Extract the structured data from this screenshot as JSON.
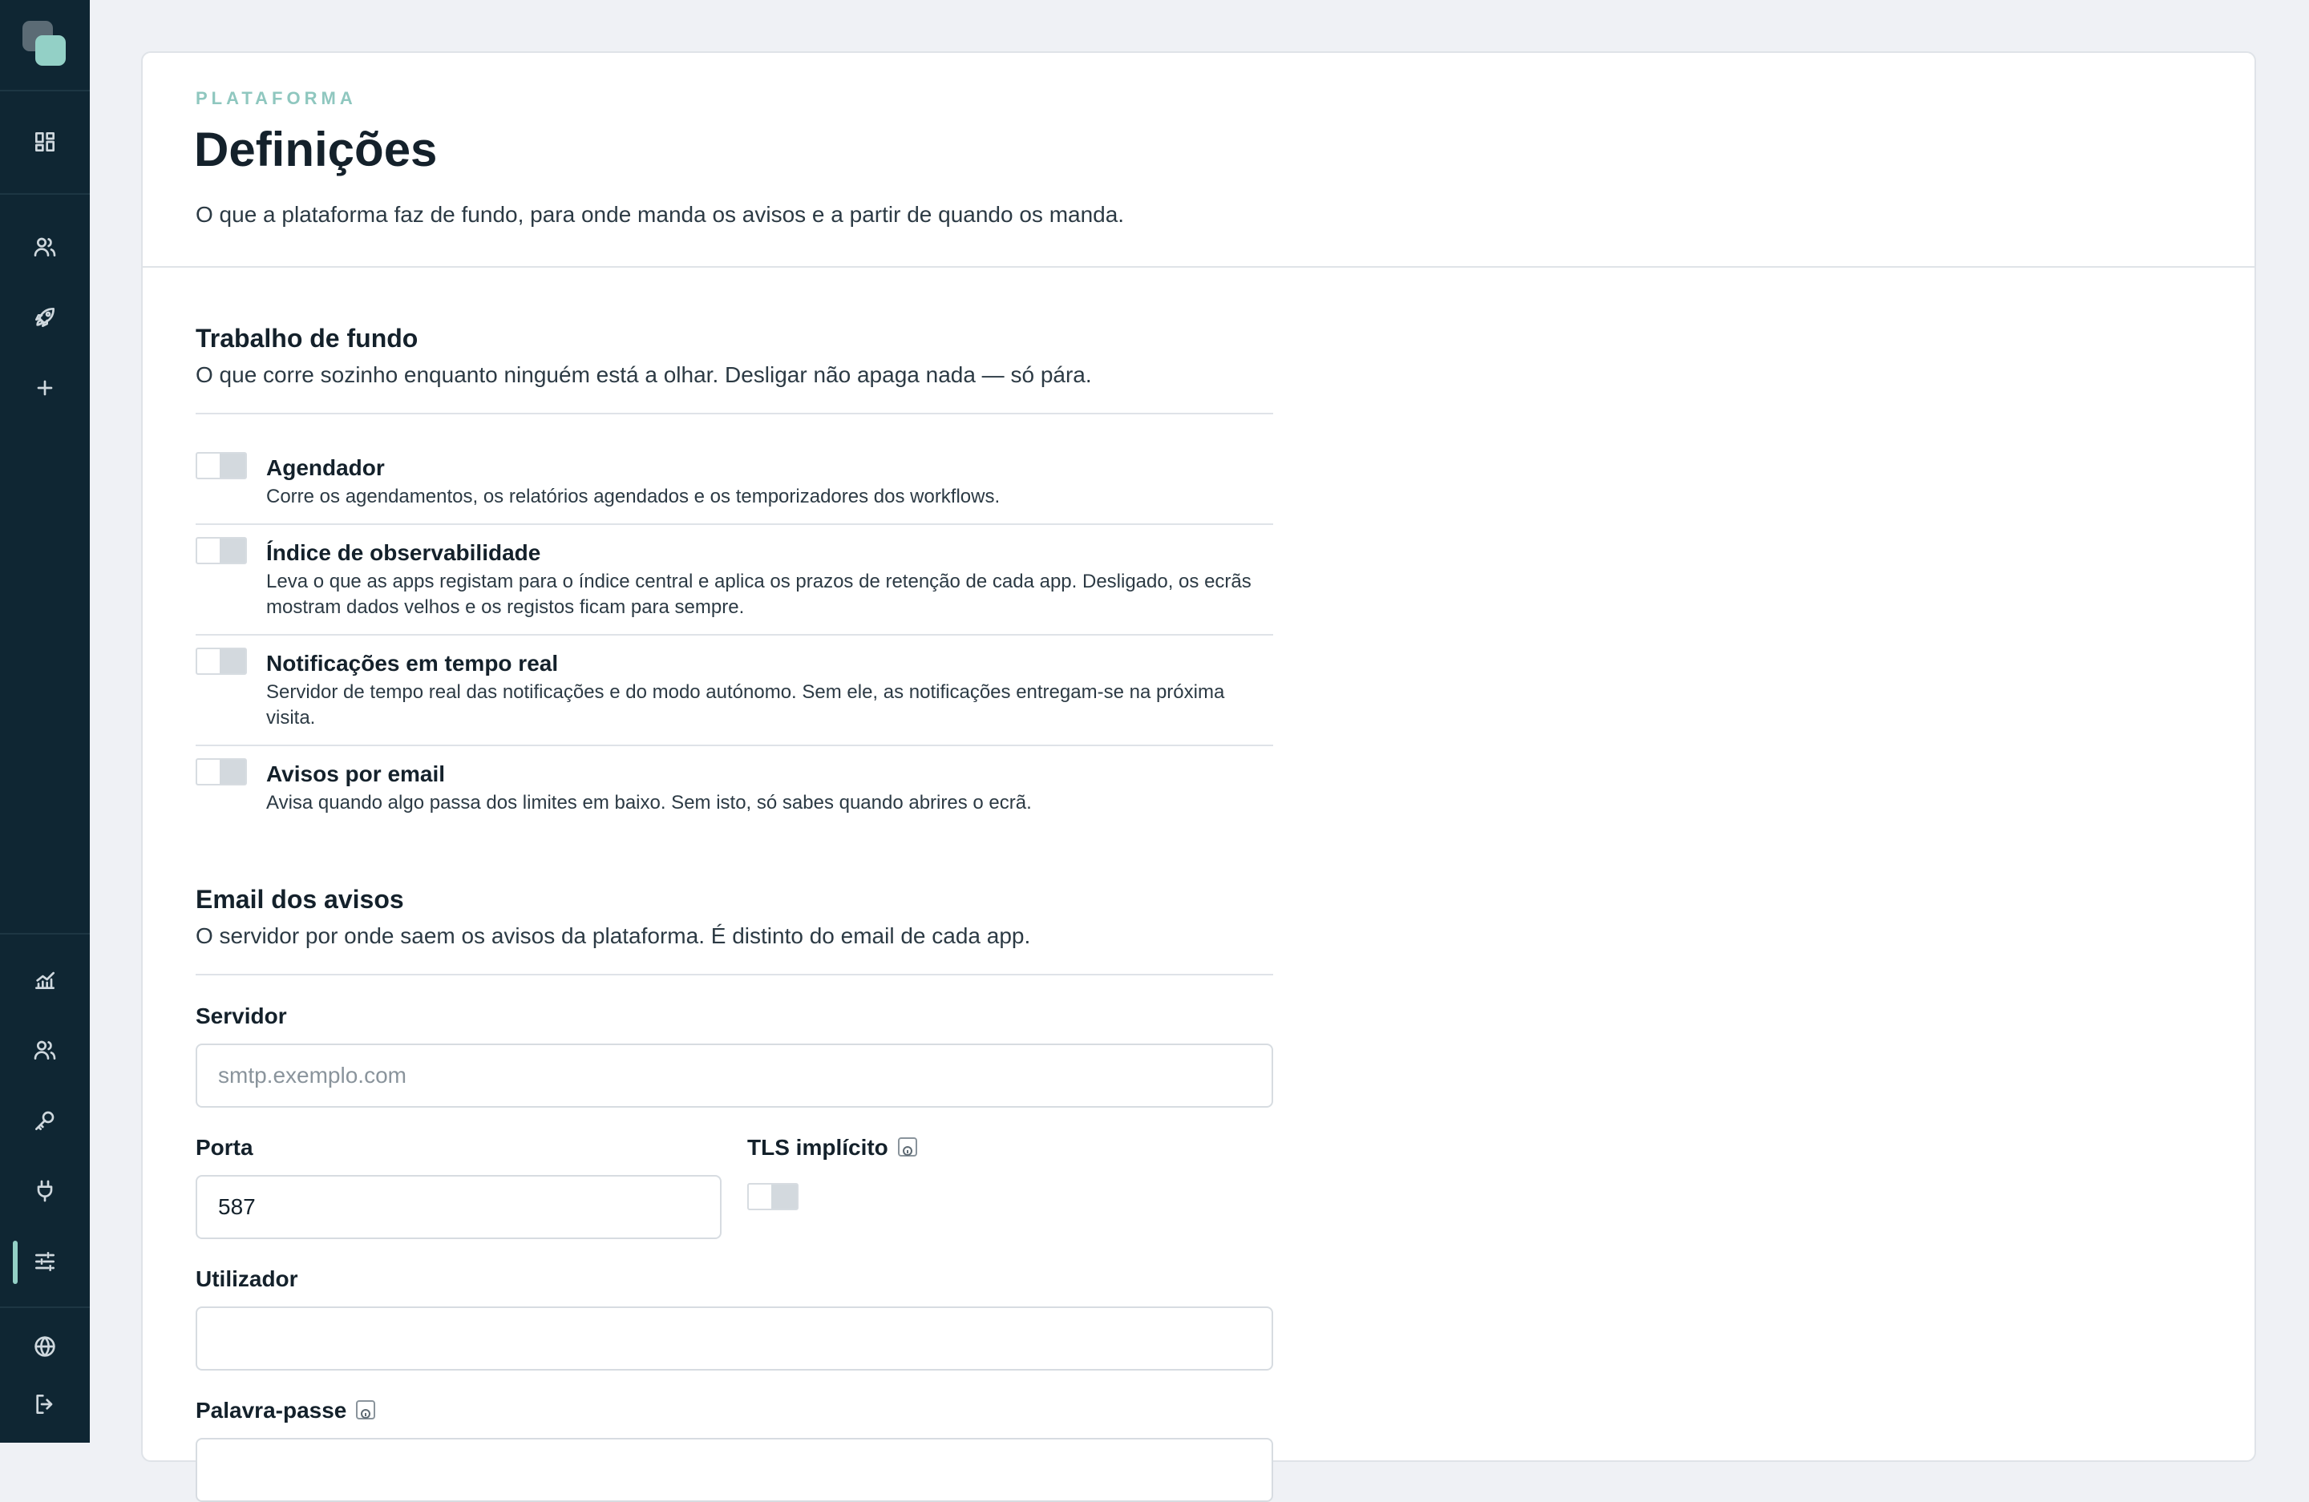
{
  "header": {
    "eyebrow": "PLATAFORMA",
    "title": "Definições",
    "description": "O que a plataforma faz de fundo, para onde manda os avisos e a partir de quando os manda."
  },
  "background_section": {
    "title": "Trabalho de fundo",
    "description": "O que corre sozinho enquanto ninguém está a olhar. Desligar não apaga nada — só pára.",
    "options": [
      {
        "title": "Agendador",
        "description": "Corre os agendamentos, os relatórios agendados e os temporizadores dos workflows.",
        "enabled": false
      },
      {
        "title": "Índice de observabilidade",
        "description": "Leva o que as apps registam para o índice central e aplica os prazos de retenção de cada app. Desligado, os ecrãs mostram dados velhos e os registos ficam para sempre.",
        "enabled": false
      },
      {
        "title": "Notificações em tempo real",
        "description": "Servidor de tempo real das notificações e do modo autónomo. Sem ele, as notificações entregam-se na próxima visita.",
        "enabled": false
      },
      {
        "title": "Avisos por email",
        "description": "Avisa quando algo passa dos limites em baixo. Sem isto, só sabes quando abrires o ecrã.",
        "enabled": false
      }
    ]
  },
  "email_section": {
    "title": "Email dos avisos",
    "description": "O servidor por onde saem os avisos da plataforma. É distinto do email de cada app.",
    "server": {
      "label": "Servidor",
      "placeholder": "smtp.exemplo.com",
      "value": ""
    },
    "port": {
      "label": "Porta",
      "value": "587"
    },
    "tls": {
      "label": "TLS implícito",
      "enabled": false
    },
    "user": {
      "label": "Utilizador",
      "value": ""
    },
    "password": {
      "label": "Palavra-passe"
    }
  },
  "sidebar": {
    "top_icons": [
      "dashboard-icon",
      "users-icon",
      "rocket-icon",
      "plus-icon"
    ],
    "bottom_icons": [
      "analytics-icon",
      "team-icon",
      "key-icon",
      "plug-icon",
      "sliders-icon",
      "globe-icon",
      "logout-icon"
    ],
    "active": "sliders-icon"
  },
  "colors": {
    "sidebar": "#0f2633",
    "accent": "#93d0c6",
    "background": "#eff1f5"
  }
}
